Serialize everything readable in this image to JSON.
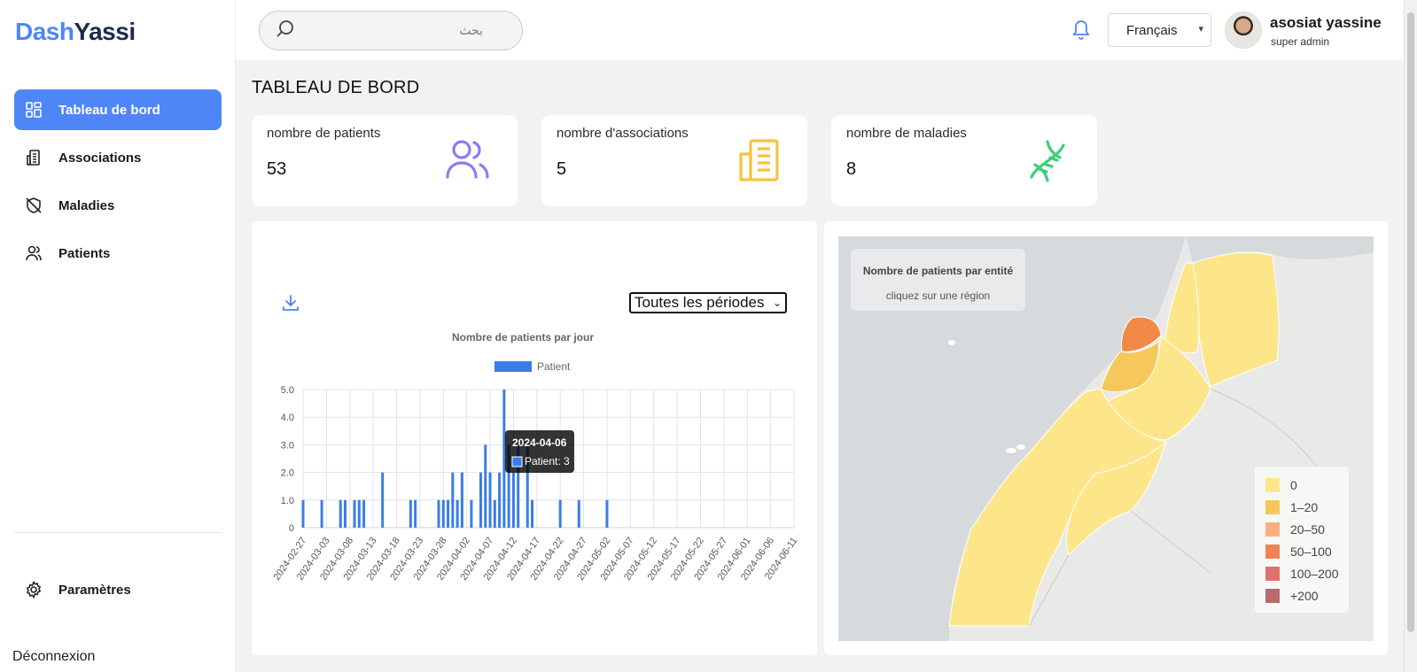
{
  "app": {
    "logo_part1": "Dash",
    "logo_part2": "Yassi"
  },
  "sidebar": {
    "items": [
      {
        "label": "Tableau de bord",
        "icon": "dashboard-icon",
        "active": true
      },
      {
        "label": "Associations",
        "icon": "building-icon"
      },
      {
        "label": "Maladies",
        "icon": "shield-off-icon"
      },
      {
        "label": "Patients",
        "icon": "users-icon"
      }
    ],
    "settings_label": "Paramètres",
    "logout_label": "Déconnexion"
  },
  "topbar": {
    "search_placeholder": "بحث",
    "language": "Français",
    "user_name": "asosiat yassine",
    "user_role": "super admin"
  },
  "page": {
    "title": "TABLEAU DE BORD"
  },
  "stats": [
    {
      "label": "nombre de patients",
      "value": "53",
      "icon": "users-icon",
      "color": "#8b7cf6"
    },
    {
      "label": "nombre d'associations",
      "value": "5",
      "icon": "building-icon",
      "color": "#f7c23e"
    },
    {
      "label": "nombre de maladies",
      "value": "8",
      "icon": "dna-icon",
      "color": "#3ccf78"
    }
  ],
  "chart_controls": {
    "period": "Toutes les périodes"
  },
  "chart_data": {
    "type": "bar",
    "title": "Nombre de patients par jour",
    "xlabel": "",
    "ylabel": "",
    "ylim": [
      0,
      5
    ],
    "yticks": [
      "0",
      "1.0",
      "2.0",
      "3.0",
      "4.0",
      "5.0"
    ],
    "xticks": [
      "2024-02-27",
      "2024-03-03",
      "2024-03-08",
      "2024-03-13",
      "2024-03-18",
      "2024-03-23",
      "2024-03-28",
      "2024-04-02",
      "2024-04-07",
      "2024-04-12",
      "2024-04-17",
      "2024-04-22",
      "2024-04-27",
      "2024-05-02",
      "2024-05-07",
      "2024-05-12",
      "2024-05-17",
      "2024-05-22",
      "2024-05-27",
      "2024-06-01",
      "2024-06-06",
      "2024-06-11"
    ],
    "series": [
      {
        "name": "Patient",
        "color": "#3b7de8",
        "x": [
          "2024-02-27",
          "2024-03-02",
          "2024-03-06",
          "2024-03-07",
          "2024-03-09",
          "2024-03-10",
          "2024-03-11",
          "2024-03-15",
          "2024-03-21",
          "2024-03-22",
          "2024-03-27",
          "2024-03-28",
          "2024-03-29",
          "2024-03-30",
          "2024-03-31",
          "2024-04-01",
          "2024-04-03",
          "2024-04-05",
          "2024-04-06",
          "2024-04-07",
          "2024-04-08",
          "2024-04-09",
          "2024-04-10",
          "2024-04-11",
          "2024-04-12",
          "2024-04-13",
          "2024-04-15",
          "2024-04-16",
          "2024-04-22",
          "2024-04-26",
          "2024-05-02"
        ],
        "values": [
          1,
          1,
          1,
          1,
          1,
          1,
          1,
          2,
          1,
          1,
          1,
          1,
          1,
          2,
          1,
          2,
          1,
          2,
          3,
          2,
          1,
          2,
          5,
          3,
          2,
          3,
          3,
          1,
          1,
          1,
          1
        ]
      }
    ],
    "tooltip": {
      "date": "2024-04-06",
      "text": "Patient: 3"
    },
    "legend_position": "top"
  },
  "map": {
    "info_title": "Nombre de patients par entité",
    "info_subtitle": "cliquez sur une région",
    "legend": [
      {
        "label": "0",
        "color": "#fde68a"
      },
      {
        "label": "1–20",
        "color": "#f6c75b"
      },
      {
        "label": "20–50",
        "color": "#f8b07e"
      },
      {
        "label": "50–100",
        "color": "#ee8453"
      },
      {
        "label": "100–200",
        "color": "#e0706e"
      },
      {
        "label": "+200",
        "color": "#b96a6a"
      }
    ]
  }
}
